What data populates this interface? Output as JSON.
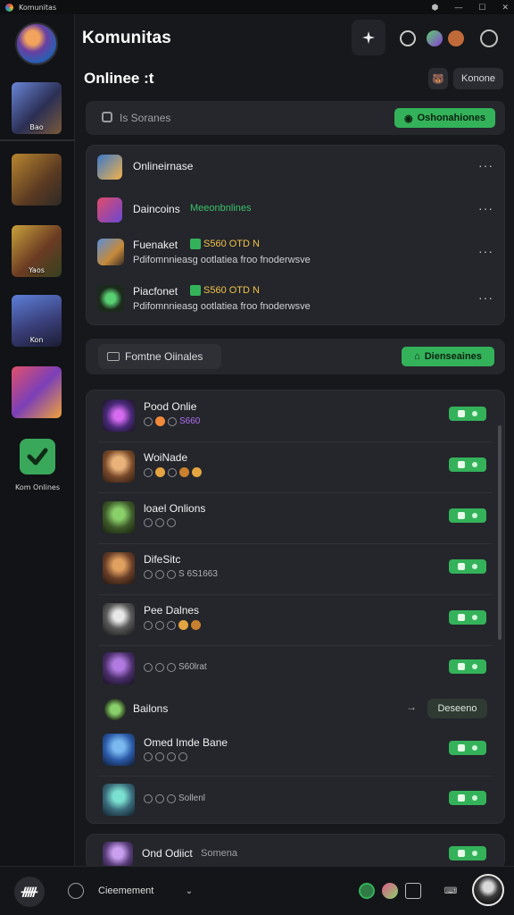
{
  "window": {
    "title": "Komunitas"
  },
  "header": {
    "title": "Komunitas"
  },
  "sidebar": {
    "tiles": [
      {
        "label": "Bao"
      },
      {
        "label": ""
      },
      {
        "label": "Yaos"
      },
      {
        "label": "Kon"
      },
      {
        "label": ""
      }
    ],
    "check_label": "Kom Onlines"
  },
  "section": {
    "title": "Onlinee :t",
    "button_label": "Konone"
  },
  "search": {
    "placeholder": "Is Soranes",
    "button_label": "Oshonahiones"
  },
  "feed": [
    {
      "title": "Onlineirnase",
      "subtitle": ""
    },
    {
      "title": "Daincoins",
      "tag": "Meeonbnlines",
      "subtitle": ""
    },
    {
      "title": "Fuenaket",
      "price": "S560 OTD N",
      "subtitle": "Pdifomnnieasg ootlatiea froo fnoderwsve"
    },
    {
      "title": "Piacfonet",
      "price": "S560 OTD N",
      "subtitle": "Pdifomnnieasg ootlatiea froo fnoderwsve"
    }
  ],
  "subbar": {
    "label": "Fomtne Oiinales",
    "button_label": "Dienseaines"
  },
  "list": [
    {
      "name": "Pood Onlie",
      "meta": "S660"
    },
    {
      "name": "WoiNade",
      "meta": ""
    },
    {
      "name": "loael Onlions",
      "meta": ""
    },
    {
      "name": "DifeSitc",
      "meta": "S 6S1663"
    },
    {
      "name": "Pee Dalnes",
      "meta": ""
    },
    {
      "name": "",
      "meta": "S60lrat"
    }
  ],
  "group": {
    "label": "Bailons",
    "button_label": "Deseeno"
  },
  "list2": [
    {
      "name": "Omed Imde Bane",
      "meta": ""
    },
    {
      "name": "",
      "meta": "Sollenl"
    }
  ],
  "last_row": {
    "name": "Ond Odiict",
    "tag": "Somena"
  },
  "footer": {
    "text": "Cieemement"
  }
}
